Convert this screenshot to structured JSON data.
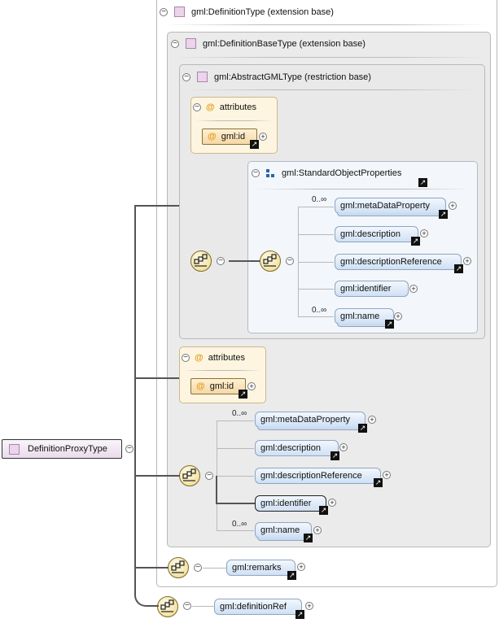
{
  "root": {
    "label": "DefinitionProxyType"
  },
  "definition_type": {
    "header": "gml:DefinitionType (extension base)"
  },
  "definition_base_type": {
    "header": "gml:DefinitionBaseType (extension base)"
  },
  "abstract_gml_type": {
    "header": "gml:AbstractGMLType (restriction base)"
  },
  "inner_attributes": {
    "label": "attributes",
    "attr": "gml:id"
  },
  "standard_props": {
    "header": "gml:StandardObjectProperties"
  },
  "inner_elements": [
    {
      "label": "gml:metaDataProperty",
      "card": "0..∞"
    },
    {
      "label": "gml:description",
      "card": ""
    },
    {
      "label": "gml:descriptionReference",
      "card": ""
    },
    {
      "label": "gml:identifier",
      "card": ""
    },
    {
      "label": "gml:name",
      "card": "0..∞"
    }
  ],
  "base_attributes": {
    "label": "attributes",
    "attr": "gml:id"
  },
  "base_elements": [
    {
      "label": "gml:metaDataProperty",
      "card": "0..∞"
    },
    {
      "label": "gml:description",
      "card": ""
    },
    {
      "label": "gml:descriptionReference",
      "card": ""
    },
    {
      "label": "gml:identifier",
      "card": ""
    },
    {
      "label": "gml:name",
      "card": "0..∞"
    }
  ],
  "remarks": {
    "label": "gml:remarks"
  },
  "definition_ref": {
    "label": "gml:definitionRef"
  },
  "icons": {
    "collapse": "−",
    "expand": "+",
    "reference": "↗",
    "attribute": "@"
  },
  "colors": {
    "element_fill": "#cfe0f4",
    "attribute_fill": "#fdf5e0",
    "type_icon": "#ecd4ec",
    "sequence_fill": "#f2e3a4"
  }
}
